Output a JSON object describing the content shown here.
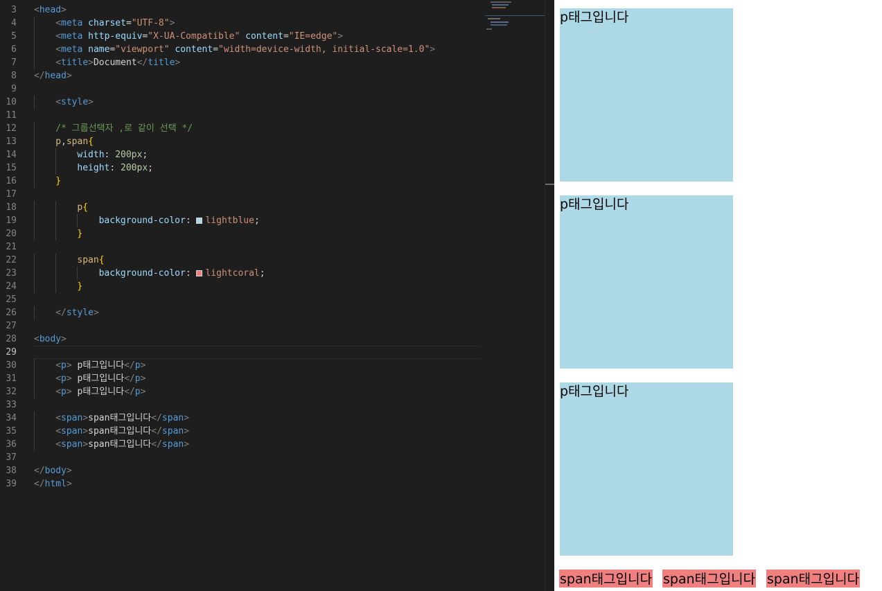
{
  "editor": {
    "lines": [
      {
        "n": "3",
        "indent": 0,
        "tokens": [
          [
            "br",
            "<"
          ],
          [
            "tag",
            "head"
          ],
          [
            "br",
            ">"
          ]
        ]
      },
      {
        "n": "4",
        "indent": 1,
        "tokens": [
          [
            "br",
            "<"
          ],
          [
            "tag",
            "meta"
          ],
          [
            "txt",
            " "
          ],
          [
            "attr",
            "charset"
          ],
          [
            "pun",
            "="
          ],
          [
            "str",
            "\"UTF-8\""
          ],
          [
            "br",
            ">"
          ]
        ]
      },
      {
        "n": "5",
        "indent": 1,
        "tokens": [
          [
            "br",
            "<"
          ],
          [
            "tag",
            "meta"
          ],
          [
            "txt",
            " "
          ],
          [
            "attr",
            "http-equiv"
          ],
          [
            "pun",
            "="
          ],
          [
            "str",
            "\"X-UA-Compatible\""
          ],
          [
            "txt",
            " "
          ],
          [
            "attr",
            "content"
          ],
          [
            "pun",
            "="
          ],
          [
            "str",
            "\"IE=edge\""
          ],
          [
            "br",
            ">"
          ]
        ]
      },
      {
        "n": "6",
        "indent": 1,
        "tokens": [
          [
            "br",
            "<"
          ],
          [
            "tag",
            "meta"
          ],
          [
            "txt",
            " "
          ],
          [
            "attr",
            "name"
          ],
          [
            "pun",
            "="
          ],
          [
            "str",
            "\"viewport\""
          ],
          [
            "txt",
            " "
          ],
          [
            "attr",
            "content"
          ],
          [
            "pun",
            "="
          ],
          [
            "str",
            "\"width=device-width, initial-scale=1.0\""
          ],
          [
            "br",
            ">"
          ]
        ]
      },
      {
        "n": "7",
        "indent": 1,
        "tokens": [
          [
            "br",
            "<"
          ],
          [
            "tag",
            "title"
          ],
          [
            "br",
            ">"
          ],
          [
            "txt",
            "Document"
          ],
          [
            "br",
            "</"
          ],
          [
            "tag",
            "title"
          ],
          [
            "br",
            ">"
          ]
        ]
      },
      {
        "n": "8",
        "indent": 0,
        "tokens": [
          [
            "br",
            "</"
          ],
          [
            "tag",
            "head"
          ],
          [
            "br",
            ">"
          ]
        ]
      },
      {
        "n": "9",
        "indent": 0,
        "tokens": []
      },
      {
        "n": "10",
        "indent": 1,
        "tokens": [
          [
            "br",
            "<"
          ],
          [
            "tag",
            "style"
          ],
          [
            "br",
            ">"
          ]
        ]
      },
      {
        "n": "11",
        "indent": 0,
        "tokens": []
      },
      {
        "n": "12",
        "indent": 1,
        "tokens": [
          [
            "cmt",
            "/* 그룹선택자 ,로 같이 선택 */"
          ]
        ]
      },
      {
        "n": "13",
        "indent": 1,
        "tokens": [
          [
            "sel",
            "p"
          ],
          [
            "pun",
            ","
          ],
          [
            "sel",
            "span"
          ],
          [
            "brace",
            "{"
          ]
        ]
      },
      {
        "n": "14",
        "indent": 2,
        "tokens": [
          [
            "prop",
            "width"
          ],
          [
            "pun",
            ": "
          ],
          [
            "num",
            "200px"
          ],
          [
            "pun",
            ";"
          ]
        ]
      },
      {
        "n": "15",
        "indent": 2,
        "tokens": [
          [
            "prop",
            "height"
          ],
          [
            "pun",
            ": "
          ],
          [
            "num",
            "200px"
          ],
          [
            "pun",
            ";"
          ]
        ]
      },
      {
        "n": "16",
        "indent": 1,
        "tokens": [
          [
            "brace",
            "}"
          ]
        ]
      },
      {
        "n": "17",
        "indent": 0,
        "tokens": []
      },
      {
        "n": "18",
        "indent": 2,
        "tokens": [
          [
            "sel",
            "p"
          ],
          [
            "brace",
            "{"
          ]
        ]
      },
      {
        "n": "19",
        "indent": 3,
        "tokens": [
          [
            "prop",
            "background-color"
          ],
          [
            "pun",
            ": "
          ],
          [
            "swatch",
            "#add8e6"
          ],
          [
            "str",
            "lightblue"
          ],
          [
            "pun",
            ";"
          ]
        ]
      },
      {
        "n": "20",
        "indent": 2,
        "tokens": [
          [
            "brace",
            "}"
          ]
        ]
      },
      {
        "n": "21",
        "indent": 0,
        "tokens": []
      },
      {
        "n": "22",
        "indent": 2,
        "tokens": [
          [
            "sel",
            "span"
          ],
          [
            "brace",
            "{"
          ]
        ]
      },
      {
        "n": "23",
        "indent": 3,
        "tokens": [
          [
            "prop",
            "background-color"
          ],
          [
            "pun",
            ": "
          ],
          [
            "swatch",
            "#f08080"
          ],
          [
            "str",
            "lightcoral"
          ],
          [
            "pun",
            ";"
          ]
        ]
      },
      {
        "n": "24",
        "indent": 2,
        "tokens": [
          [
            "brace",
            "}"
          ]
        ]
      },
      {
        "n": "25",
        "indent": 0,
        "tokens": []
      },
      {
        "n": "26",
        "indent": 1,
        "tokens": [
          [
            "br",
            "</"
          ],
          [
            "tag",
            "style"
          ],
          [
            "br",
            ">"
          ]
        ]
      },
      {
        "n": "27",
        "indent": 0,
        "tokens": []
      },
      {
        "n": "28",
        "indent": 0,
        "tokens": [
          [
            "br",
            "<"
          ],
          [
            "tag",
            "body"
          ],
          [
            "br",
            ">"
          ]
        ]
      },
      {
        "n": "29",
        "indent": 0,
        "tokens": [],
        "current": true
      },
      {
        "n": "30",
        "indent": 1,
        "tokens": [
          [
            "br",
            "<"
          ],
          [
            "tag",
            "p"
          ],
          [
            "br",
            ">"
          ],
          [
            "txt",
            " p태그입니다"
          ],
          [
            "br",
            "</"
          ],
          [
            "tag",
            "p"
          ],
          [
            "br",
            ">"
          ]
        ]
      },
      {
        "n": "31",
        "indent": 1,
        "tokens": [
          [
            "br",
            "<"
          ],
          [
            "tag",
            "p"
          ],
          [
            "br",
            ">"
          ],
          [
            "txt",
            " p태그입니다"
          ],
          [
            "br",
            "</"
          ],
          [
            "tag",
            "p"
          ],
          [
            "br",
            ">"
          ]
        ]
      },
      {
        "n": "32",
        "indent": 1,
        "tokens": [
          [
            "br",
            "<"
          ],
          [
            "tag",
            "p"
          ],
          [
            "br",
            ">"
          ],
          [
            "txt",
            " p태그입니다"
          ],
          [
            "br",
            "</"
          ],
          [
            "tag",
            "p"
          ],
          [
            "br",
            ">"
          ]
        ]
      },
      {
        "n": "33",
        "indent": 0,
        "tokens": []
      },
      {
        "n": "34",
        "indent": 1,
        "tokens": [
          [
            "br",
            "<"
          ],
          [
            "tag",
            "span"
          ],
          [
            "br",
            ">"
          ],
          [
            "txt",
            "span태그입니다"
          ],
          [
            "br",
            "</"
          ],
          [
            "tag",
            "span"
          ],
          [
            "br",
            ">"
          ]
        ]
      },
      {
        "n": "35",
        "indent": 1,
        "tokens": [
          [
            "br",
            "<"
          ],
          [
            "tag",
            "span"
          ],
          [
            "br",
            ">"
          ],
          [
            "txt",
            "span태그입니다"
          ],
          [
            "br",
            "</"
          ],
          [
            "tag",
            "span"
          ],
          [
            "br",
            ">"
          ]
        ]
      },
      {
        "n": "36",
        "indent": 1,
        "tokens": [
          [
            "br",
            "<"
          ],
          [
            "tag",
            "span"
          ],
          [
            "br",
            ">"
          ],
          [
            "txt",
            "span태그입니다"
          ],
          [
            "br",
            "</"
          ],
          [
            "tag",
            "span"
          ],
          [
            "br",
            ">"
          ]
        ]
      },
      {
        "n": "37",
        "indent": 0,
        "tokens": []
      },
      {
        "n": "38",
        "indent": 0,
        "tokens": [
          [
            "br",
            "</"
          ],
          [
            "tag",
            "body"
          ],
          [
            "br",
            ">"
          ]
        ]
      },
      {
        "n": "39",
        "indent": 0,
        "tokens": [
          [
            "br",
            "</"
          ],
          [
            "tag",
            "html"
          ],
          [
            "br",
            ">"
          ]
        ]
      }
    ]
  },
  "preview": {
    "paragraphs": [
      "p태그입니다",
      "p태그입니다",
      "p태그입니다"
    ],
    "spans": [
      "span태그입니다",
      "span태그입니다",
      "span태그입니다"
    ]
  },
  "colors": {
    "editor_bg": "#1e1e1e",
    "lightblue": "#add8e6",
    "lightcoral": "#f08080"
  }
}
